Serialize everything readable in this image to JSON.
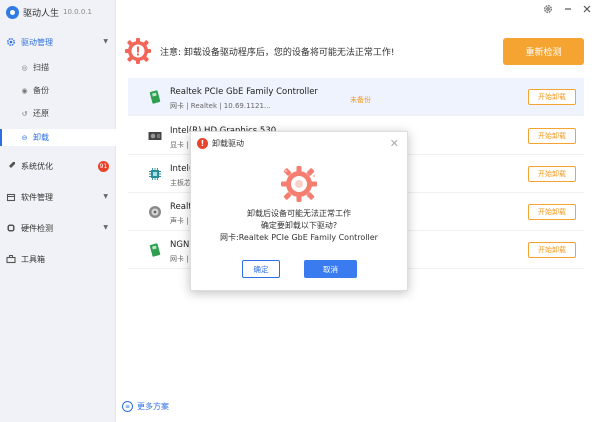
{
  "app": {
    "name": "驱动人生",
    "version": "10.0.0.1"
  },
  "sidebar": {
    "groups": [
      {
        "label": "驱动管理",
        "icon": "gear-icon"
      },
      {
        "label": "系统优化",
        "icon": "rocket-icon",
        "badge": "91"
      },
      {
        "label": "软件管理",
        "icon": "box-icon"
      },
      {
        "label": "硬件检测",
        "icon": "hardware-icon"
      },
      {
        "label": "工具箱",
        "icon": "toolbox-icon"
      }
    ],
    "sub_items": [
      {
        "label": "扫描",
        "icon": "scan-icon"
      },
      {
        "label": "备份",
        "icon": "backup-icon"
      },
      {
        "label": "还原",
        "icon": "restore-icon"
      },
      {
        "label": "卸载",
        "icon": "uninstall-icon"
      }
    ],
    "more_solutions": "更多方案"
  },
  "notice": {
    "text": "注意: 卸载设备驱动程序后，您的设备将可能无法正常工作!",
    "recheck_label": "重新检测"
  },
  "drivers": [
    {
      "name": "Realtek PCIe GbE Family Controller",
      "meta": "网卡 | Realtek    | 10.69.1121...",
      "status": "未备份",
      "action": "开始卸载",
      "icon": "network-card-icon"
    },
    {
      "name": "Intel(R) HD Graphics 530",
      "meta": "显卡 | ...",
      "status": "",
      "action": "开始卸载",
      "icon": "graphics-card-icon"
    },
    {
      "name": "Intel(R) ...",
      "meta": "主板芯...",
      "status": "",
      "action": "开始卸载",
      "icon": "chipset-icon"
    },
    {
      "name": "Realt...",
      "meta": "声卡 | ...",
      "status": "",
      "action": "开始卸载",
      "icon": "audio-icon"
    },
    {
      "name": "NGN...",
      "meta": "网卡 | ...",
      "status": "",
      "action": "开始卸载",
      "icon": "network-card-icon"
    }
  ],
  "dialog": {
    "title": "卸载驱动",
    "line1": "卸载后设备可能无法正常工作",
    "line2": "确定要卸载以下驱动?",
    "line3": "网卡:Realtek PCIe GbE Family Controller",
    "ok_label": "确定",
    "cancel_label": "取消"
  },
  "colors": {
    "accent": "#2f6fe4",
    "orange": "#f5a432",
    "alert_red": "#e8432b"
  }
}
